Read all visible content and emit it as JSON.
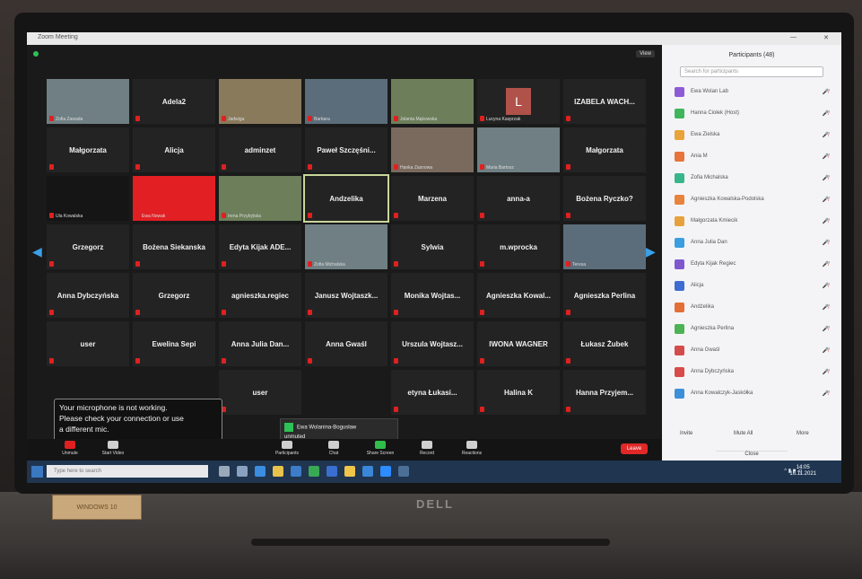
{
  "window": {
    "title": "Zoom Meeting",
    "view_label": "View",
    "min": "—",
    "close": "✕"
  },
  "tiles": [
    {
      "row": 0,
      "col": 0,
      "type": "video",
      "label": "",
      "tag": "Zofia Zawada"
    },
    {
      "row": 0,
      "col": 1,
      "type": "name",
      "label": "Adela2"
    },
    {
      "row": 0,
      "col": 2,
      "type": "video",
      "label": "",
      "tag": "Jadwiga"
    },
    {
      "row": 0,
      "col": 3,
      "type": "video",
      "label": "",
      "tag": "Barbara"
    },
    {
      "row": 0,
      "col": 4,
      "type": "video",
      "label": "",
      "tag": "Jolanta Mąkowska"
    },
    {
      "row": 0,
      "col": 5,
      "type": "initial",
      "label": "L",
      "tag": "Lucyna Kasprzak"
    },
    {
      "row": 0,
      "col": 6,
      "type": "name",
      "label": "IZABELA WACH..."
    },
    {
      "row": 1,
      "col": 0,
      "type": "name",
      "label": "Małgorzata"
    },
    {
      "row": 1,
      "col": 1,
      "type": "name",
      "label": "Alicja"
    },
    {
      "row": 1,
      "col": 2,
      "type": "name",
      "label": "adminzet"
    },
    {
      "row": 1,
      "col": 3,
      "type": "name",
      "label": "Paweł Szczęśni..."
    },
    {
      "row": 1,
      "col": 4,
      "type": "video",
      "label": "",
      "tag": "Hanka Zasnowa"
    },
    {
      "row": 1,
      "col": 5,
      "type": "video",
      "label": "",
      "tag": "Maria Bartosz"
    },
    {
      "row": 1,
      "col": 6,
      "type": "name",
      "label": "Małgorzata"
    },
    {
      "row": 2,
      "col": 0,
      "type": "dark",
      "label": "",
      "tag": "Ula Kowalska"
    },
    {
      "row": 2,
      "col": 1,
      "type": "red",
      "label": "",
      "tag": "Ewa Nowak"
    },
    {
      "row": 2,
      "col": 2,
      "type": "video",
      "label": "",
      "tag": "Irena Przybylska"
    },
    {
      "row": 2,
      "col": 3,
      "type": "active",
      "label": "Andzelika"
    },
    {
      "row": 2,
      "col": 4,
      "type": "name",
      "label": "Marzena"
    },
    {
      "row": 2,
      "col": 5,
      "type": "name",
      "label": "anna-a"
    },
    {
      "row": 2,
      "col": 6,
      "type": "name",
      "label": "Bożena Ryczko?"
    },
    {
      "row": 3,
      "col": 0,
      "type": "name",
      "label": "Grzegorz"
    },
    {
      "row": 3,
      "col": 1,
      "type": "name",
      "label": "Bożena Siekanska"
    },
    {
      "row": 3,
      "col": 2,
      "type": "name",
      "label": "Edyta Kijak ADE..."
    },
    {
      "row": 3,
      "col": 3,
      "type": "video",
      "label": "",
      "tag": "Zofia Michalska"
    },
    {
      "row": 3,
      "col": 4,
      "type": "name",
      "label": "Sylwia"
    },
    {
      "row": 3,
      "col": 5,
      "type": "name",
      "label": "m.wprocka"
    },
    {
      "row": 3,
      "col": 6,
      "type": "video",
      "label": "",
      "tag": "Teresa"
    },
    {
      "row": 4,
      "col": 0,
      "type": "name",
      "label": "Anna Dybczyńska"
    },
    {
      "row": 4,
      "col": 1,
      "type": "name",
      "label": "Grzegorz"
    },
    {
      "row": 4,
      "col": 2,
      "type": "name",
      "label": "agnieszka.regiec"
    },
    {
      "row": 4,
      "col": 3,
      "type": "name",
      "label": "Janusz Wojtaszk..."
    },
    {
      "row": 4,
      "col": 4,
      "type": "name",
      "label": "Monika Wojtas..."
    },
    {
      "row": 4,
      "col": 5,
      "type": "name",
      "label": "Agnieszka Kowal..."
    },
    {
      "row": 4,
      "col": 6,
      "type": "name",
      "label": "Agnieszka Perlina"
    },
    {
      "row": 5,
      "col": 0,
      "type": "name",
      "label": "user"
    },
    {
      "row": 5,
      "col": 1,
      "type": "name",
      "label": "Ewelina Sepi"
    },
    {
      "row": 5,
      "col": 2,
      "type": "name",
      "label": "Anna Julia Dan..."
    },
    {
      "row": 5,
      "col": 3,
      "type": "name",
      "label": "Anna Gwaśl"
    },
    {
      "row": 5,
      "col": 4,
      "type": "name",
      "label": "Urszula Wojtasz..."
    },
    {
      "row": 5,
      "col": 5,
      "type": "name",
      "label": "IWONA WAGNER"
    },
    {
      "row": 5,
      "col": 6,
      "type": "name",
      "label": "Łukasz Żubek"
    },
    {
      "row": 6,
      "col": 2,
      "type": "name",
      "label": "user"
    },
    {
      "row": 6,
      "col": 4,
      "type": "name",
      "label": "etyna Łukasi..."
    },
    {
      "row": 6,
      "col": 5,
      "type": "name",
      "label": "Halina K"
    },
    {
      "row": 6,
      "col": 6,
      "type": "name",
      "label": "Hanna Przyjem..."
    }
  ],
  "popup": {
    "line1": "Your microphone is not working.",
    "line2": "Please check your connection or use",
    "line3": "a different mic."
  },
  "notice": {
    "title": "Ewa Wolanina-Bogusław",
    "sub": "unmuted"
  },
  "toolbar": {
    "unmute": "Unmute",
    "video": "Start Video",
    "participants": "Participants",
    "chat": "Chat",
    "share": "Share Screen",
    "record": "Record",
    "reactions": "Reactions",
    "end": "Leave"
  },
  "panel": {
    "title": "Participants (48)",
    "search": "Search for participants",
    "participants": [
      {
        "name": "Ewa Wolan Lab",
        "color": "#8e5bd6"
      },
      {
        "name": "Hanna Ciołek (Host)",
        "color": "#3fb65c"
      },
      {
        "name": "Ewa Zielska",
        "color": "#e9a33a"
      },
      {
        "name": "Ania M",
        "color": "#e7743a"
      },
      {
        "name": "Zofia Michalska",
        "color": "#39b58b"
      },
      {
        "name": "Agnieszka Kowalska-Podolska",
        "color": "#e8833c"
      },
      {
        "name": "Małgorzata Kmiecik",
        "color": "#e6a13c"
      },
      {
        "name": "Anna Julia Dan",
        "color": "#3a9ee0"
      },
      {
        "name": "Edyta Kijak Regiec",
        "color": "#7f58cf"
      },
      {
        "name": "Alicja",
        "color": "#3f6cd0"
      },
      {
        "name": "Andżelika",
        "color": "#e46f36"
      },
      {
        "name": "Agnieszka Perlina",
        "color": "#4db254"
      },
      {
        "name": "Anna Gwaśl",
        "color": "#d44b4b"
      },
      {
        "name": "Anna Dybczyńska",
        "color": "#d94a4a"
      },
      {
        "name": "Anna Kowalczyk-Jaskółka",
        "color": "#3d8fd9"
      }
    ],
    "invite": "Invite",
    "mute_all": "Mute All",
    "more": "More",
    "close": "Close"
  },
  "taskbar": {
    "search": "Type here to search",
    "time": "14:05",
    "date": "16.11.2021"
  },
  "laptop": {
    "brand": "DELL",
    "sticker": "WINDOWS 10"
  }
}
